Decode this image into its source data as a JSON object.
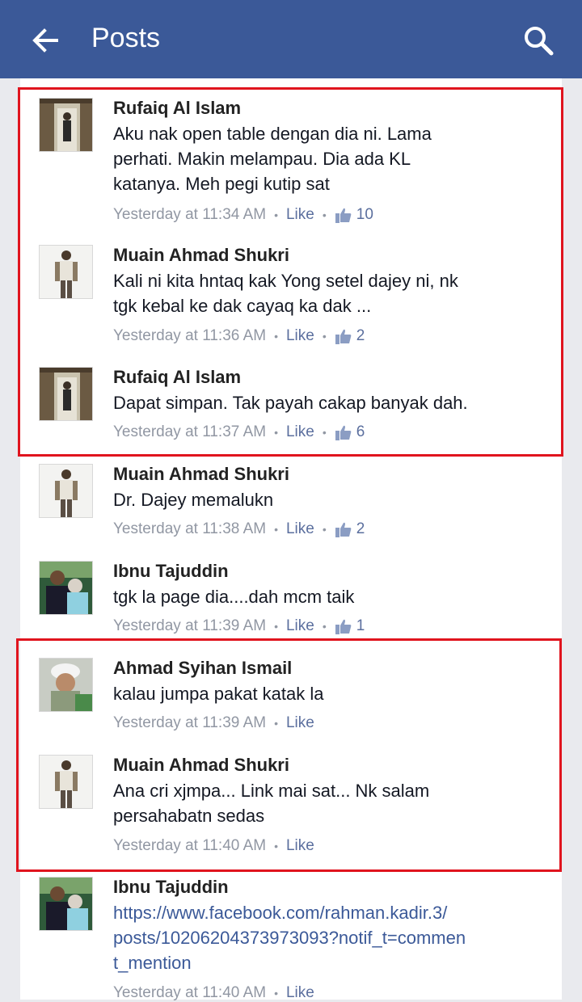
{
  "header": {
    "title": "Posts"
  },
  "comments": [
    {
      "name": "Rufaiq Al Islam",
      "text": "Aku nak open table dengan dia ni. Lama\nperhati. Makin melampau. Dia ada KL\nkatanya. Meh pegi kutip sat",
      "time": "Yesterday at 11:34 AM",
      "like": "Like",
      "likes": "10"
    },
    {
      "name": "Muain Ahmad Shukri",
      "text": "Kali ni kita hntaq kak Yong setel dajey ni, nk\ntgk kebal ke dak cayaq ka dak ...",
      "time": "Yesterday at 11:36 AM",
      "like": "Like",
      "likes": "2"
    },
    {
      "name": "Rufaiq Al Islam",
      "text": "Dapat simpan. Tak payah cakap banyak dah.",
      "time": "Yesterday at 11:37 AM",
      "like": "Like",
      "likes": "6"
    },
    {
      "name": "Muain Ahmad Shukri",
      "text": "Dr. Dajey memalukn",
      "time": "Yesterday at 11:38 AM",
      "like": "Like",
      "likes": "2"
    },
    {
      "name": "Ibnu Tajuddin",
      "text": "tgk la page dia....dah mcm taik",
      "time": "Yesterday at 11:39 AM",
      "like": "Like",
      "likes": "1"
    },
    {
      "name": "Ahmad Syihan Ismail",
      "text": "kalau jumpa pakat katak la",
      "time": "Yesterday at 11:39 AM",
      "like": "Like",
      "likes": ""
    },
    {
      "name": "Muain Ahmad Shukri",
      "text": "Ana cri xjmpa...  Link mai sat...  Nk salam\npersahabatn sedas",
      "time": "Yesterday at 11:40 AM",
      "like": "Like",
      "likes": ""
    },
    {
      "name": "Ibnu Tajuddin",
      "text": "https://www.facebook.com/rahman.kadir.3/\nposts/10206204373973093?notif_t=commen\nt_mention",
      "time": "Yesterday at 11:40 AM",
      "like": "Like",
      "likes": ""
    }
  ]
}
